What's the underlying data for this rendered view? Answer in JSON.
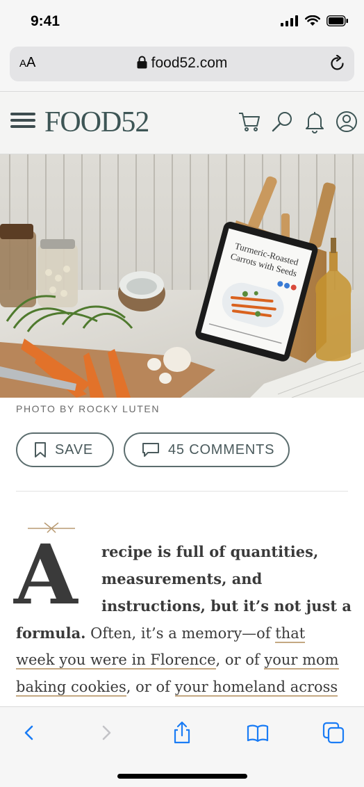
{
  "status_bar": {
    "time": "9:41"
  },
  "browser": {
    "aa_small": "A",
    "aa_large": "A",
    "url": "food52.com"
  },
  "site": {
    "logo": "FOOD52",
    "icons": [
      "hamburger-icon",
      "cart-icon",
      "search-icon",
      "bell-icon",
      "account-icon"
    ]
  },
  "hero": {
    "tablet_title_line1": "Turmeric-Roasted",
    "tablet_title_line2": "Carrots with Seeds"
  },
  "photo_credit": "PHOTO BY ROCKY LUTEN",
  "actions": {
    "save_label": "SAVE",
    "comments_label": "45 COMMENTS"
  },
  "article": {
    "drop_cap": "A",
    "line1": "recipe is full of quantities,",
    "line2": "measurements, and",
    "line3": "instructions, but it’s not just a",
    "line4_bold": "formula.",
    "line4_rest": " Often, it’s a memory—of ",
    "line4_link": "that",
    "line5_link": "week you were in Florence",
    "line5_rest": ", or of ",
    "line5_link2": "your mom",
    "line6_link": "baking cookies",
    "line6_rest": ", or of ",
    "line6_link2": "your homeland across"
  },
  "colors": {
    "brand": "#3d5555",
    "link_underline": "#c4a882",
    "ios_blue": "#1a7cf5"
  }
}
